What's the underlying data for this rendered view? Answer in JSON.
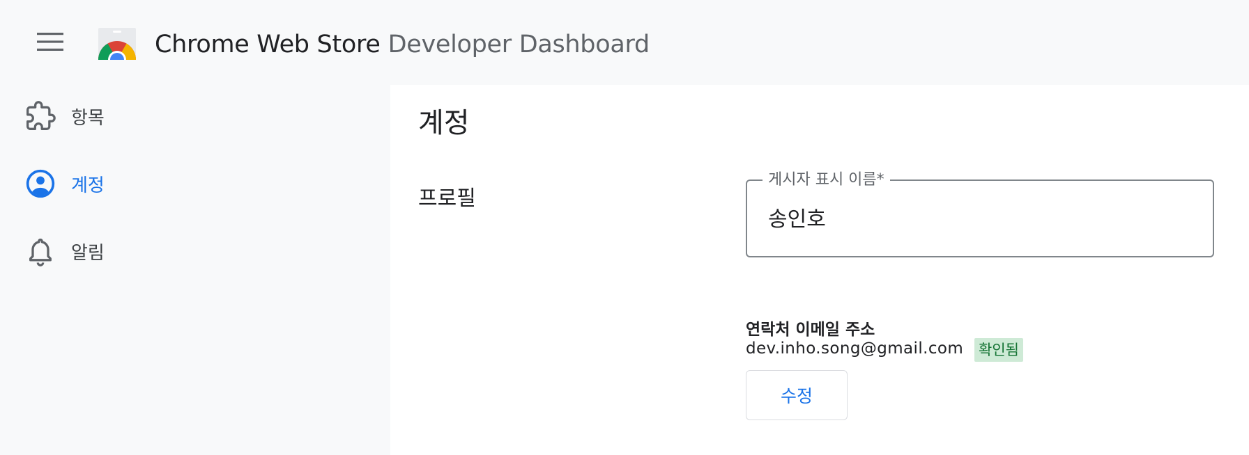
{
  "header": {
    "title_primary": "Chrome Web Store",
    "title_secondary": "Developer Dashboard",
    "menu_icon": "hamburger-menu-icon",
    "logo_icon": "chrome-web-store-logo"
  },
  "sidebar": {
    "items": [
      {
        "label": "항목",
        "icon": "puzzle-piece-icon",
        "active": false
      },
      {
        "label": "계정",
        "icon": "account-circle-icon",
        "active": true
      },
      {
        "label": "알림",
        "icon": "bell-icon",
        "active": false
      }
    ]
  },
  "main": {
    "page_title": "계정",
    "section_title": "프로필",
    "publisher_field": {
      "label": "게시자 표시 이름*",
      "value": "송인호"
    },
    "email": {
      "label": "연락처 이메일 주소",
      "value": "dev.inho.song@gmail.com",
      "badge": "확인됨"
    },
    "edit_button": "수정"
  },
  "colors": {
    "accent": "#1a73e8",
    "sidebar_bg": "#f8f9fa",
    "badge_bg": "#ceead6",
    "badge_text": "#137333"
  }
}
